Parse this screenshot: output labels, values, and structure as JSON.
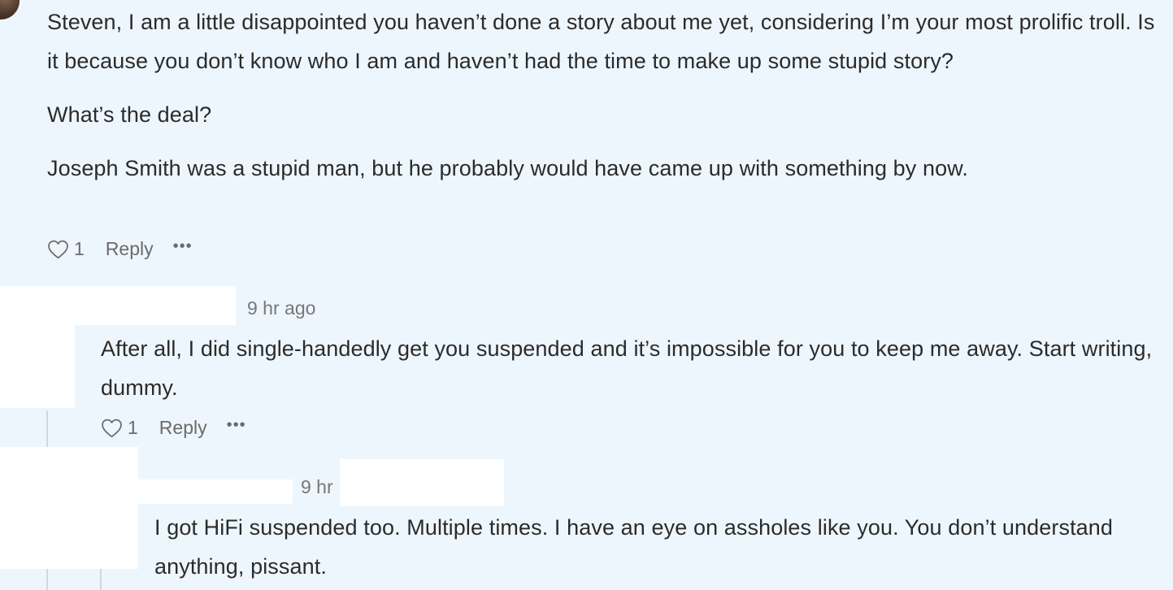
{
  "comments": [
    {
      "paragraphs": [
        "Steven, I am a little disappointed you haven’t done a story about me yet, considering I’m your most prolific troll. Is it because you don’t know who I am and haven’t had the time to make up some stupid story?",
        "What’s the deal?",
        "Joseph Smith was a stupid man, but he probably would have came up with something by now."
      ],
      "likes": "1",
      "reply_label": "Reply",
      "more_label": "•••"
    },
    {
      "timestamp": "9 hr ago",
      "text": "After all, I did single-handedly get you suspended and it’s impossible for you to keep me away. Start writing, dummy.",
      "likes": "1",
      "reply_label": "Reply",
      "more_label": "•••"
    },
    {
      "timestamp": "9 hr",
      "text": "I got HiFi suspended too. Multiple times. I have an eye on assholes like you. You don’t understand anything, pissant."
    }
  ],
  "icons": {
    "like": "heart-outline-icon",
    "more": "ellipsis-icon"
  },
  "colors": {
    "background": "#eef6fd",
    "text": "#2b2b2b",
    "muted": "#6b6b6b",
    "thread_line": "#cfd8e0"
  }
}
